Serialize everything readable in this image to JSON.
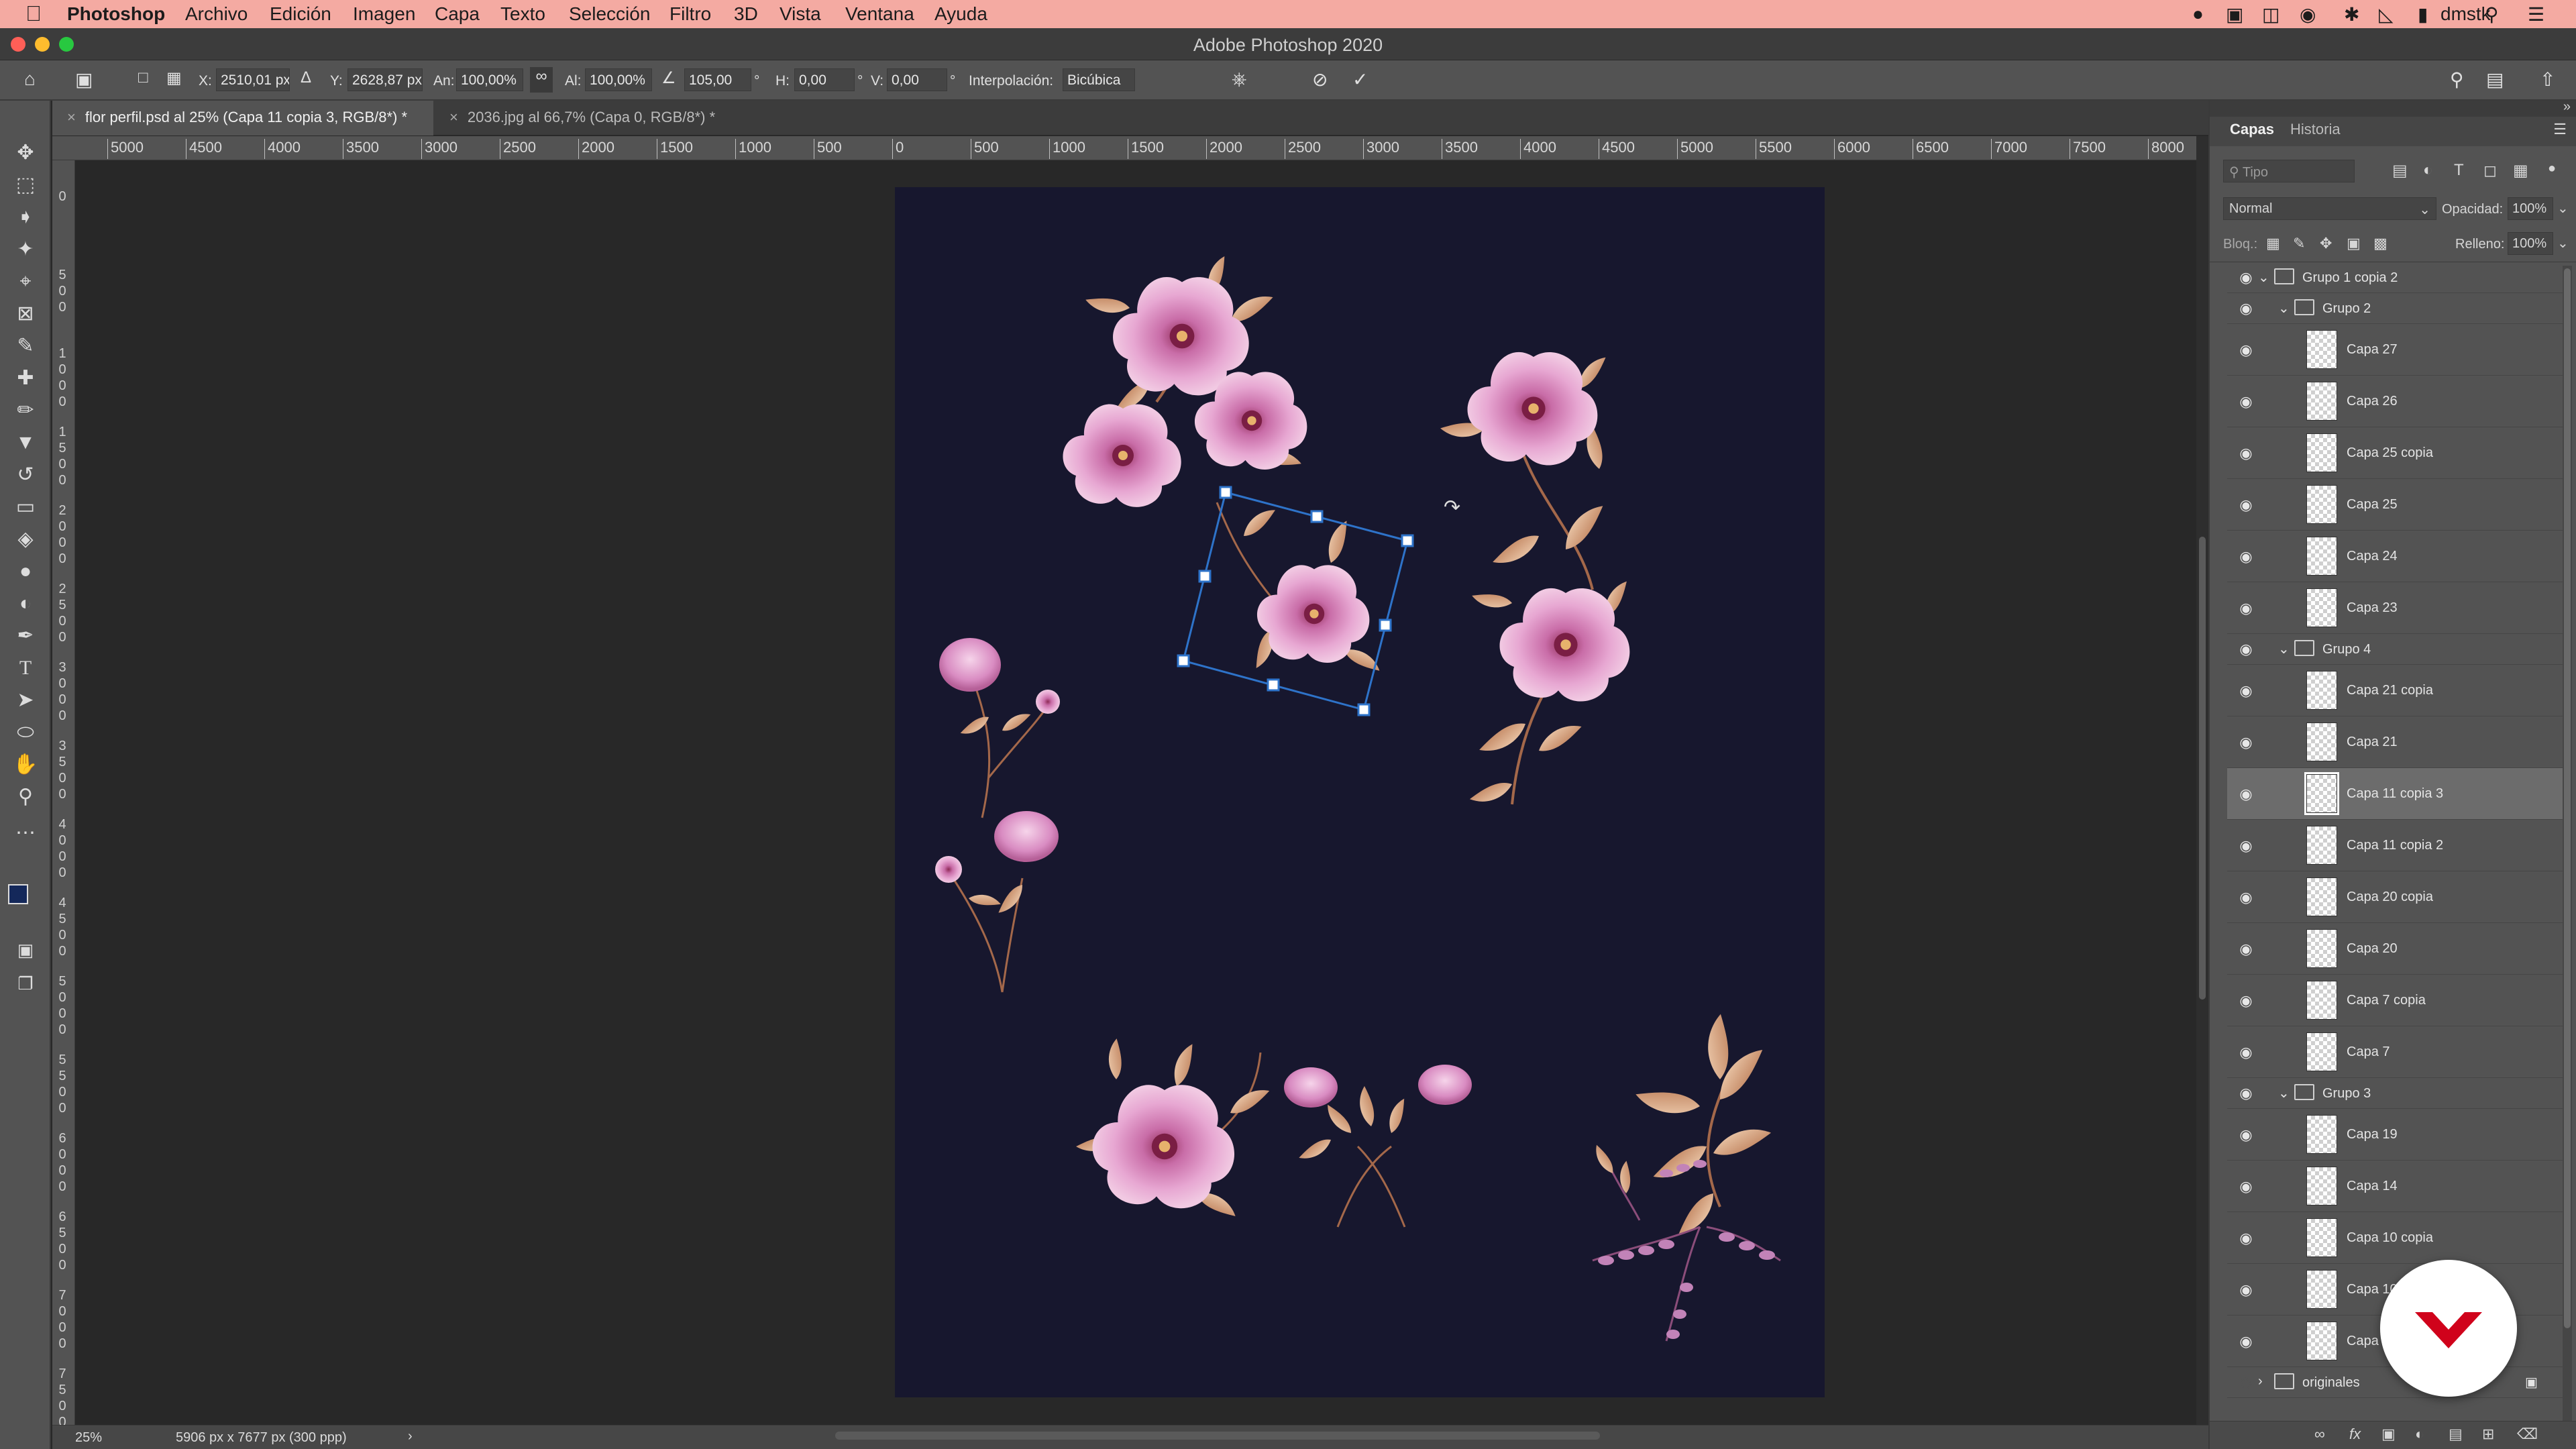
{
  "menubar": {
    "app_name": "Photoshop",
    "items": [
      "Archivo",
      "Edición",
      "Imagen",
      "Capa",
      "Texto",
      "Selección",
      "Filtro",
      "3D",
      "Vista",
      "Ventana",
      "Ayuda"
    ],
    "user": "dmstk"
  },
  "window": {
    "title": "Adobe Photoshop 2020"
  },
  "options": {
    "x_label": "X:",
    "x_value": "2510,01 px",
    "y_label": "Y:",
    "y_value": "2628,87 px",
    "w_label": "An:",
    "w_value": "100,00%",
    "h_label": "Al:",
    "h_value": "100,00%",
    "angle_value": "105,00",
    "deg": "°",
    "skew_h_label": "H:",
    "skew_h_value": "0,00",
    "skew_v_label": "V:",
    "skew_v_value": "0,00",
    "interp_label": "Interpolación:",
    "interp_value": "Bicúbica"
  },
  "tabs": [
    {
      "label": "flor perfil.psd al 25% (Capa 11 copia 3, RGB/8*) *",
      "active": true
    },
    {
      "label": "2036.jpg al 66,7% (Capa 0, RGB/8*) *",
      "active": false
    }
  ],
  "ruler_top": [
    "5000",
    "4500",
    "4000",
    "3500",
    "3000",
    "2500",
    "2000",
    "1500",
    "1000",
    "500",
    "0",
    "500",
    "1000",
    "1500",
    "2000",
    "2500",
    "3000",
    "3500",
    "4000",
    "4500",
    "5000",
    "5500",
    "6000",
    "6500",
    "7000",
    "7500",
    "8000"
  ],
  "ruler_left": [
    "0",
    "5 0 0",
    "1 0 0 0",
    "1 5 0 0",
    "2 0 0 0",
    "2 5 0 0",
    "3 0 0 0",
    "3 5 0 0",
    "4 0 0 0",
    "4 5 0 0",
    "5 0 0 0",
    "5 5 0 0",
    "6 0 0 0",
    "6 5 0 0",
    "7 0 0 0",
    "7 5 0 0"
  ],
  "status": {
    "zoom": "25%",
    "doc_size": "5906 px x 7677 px (300 ppp)"
  },
  "panel": {
    "tab_layers": "Capas",
    "tab_history": "Historia",
    "search_placeholder": "Tipo",
    "blend_mode": "Normal",
    "opacity_label": "Opacidad:",
    "opacity_value": "100%",
    "lock_label": "Bloq.:",
    "fill_label": "Relleno:",
    "fill_value": "100%",
    "layers": [
      {
        "name": "Grupo 1 copia 2",
        "type": "group",
        "level": 0,
        "open": true
      },
      {
        "name": "Grupo 2",
        "type": "group",
        "level": 1,
        "open": true
      },
      {
        "name": "Capa 27",
        "type": "layer",
        "level": 2
      },
      {
        "name": "Capa 26",
        "type": "layer",
        "level": 2
      },
      {
        "name": "Capa 25 copia",
        "type": "layer",
        "level": 2
      },
      {
        "name": "Capa 25",
        "type": "layer",
        "level": 2
      },
      {
        "name": "Capa 24",
        "type": "layer",
        "level": 2
      },
      {
        "name": "Capa 23",
        "type": "layer",
        "level": 2
      },
      {
        "name": "Grupo 4",
        "type": "group",
        "level": 1,
        "open": true
      },
      {
        "name": "Capa 21 copia",
        "type": "layer",
        "level": 2
      },
      {
        "name": "Capa 21",
        "type": "layer",
        "level": 2
      },
      {
        "name": "Capa 11 copia 3",
        "type": "layer",
        "level": 2,
        "selected": true
      },
      {
        "name": "Capa 11 copia 2",
        "type": "layer",
        "level": 2
      },
      {
        "name": "Capa 20 copia",
        "type": "layer",
        "level": 2
      },
      {
        "name": "Capa 20",
        "type": "layer",
        "level": 2
      },
      {
        "name": "Capa 7 copia",
        "type": "layer",
        "level": 2
      },
      {
        "name": "Capa 7",
        "type": "layer",
        "level": 2
      },
      {
        "name": "Grupo 3",
        "type": "group",
        "level": 1,
        "open": true
      },
      {
        "name": "Capa 19",
        "type": "layer",
        "level": 2
      },
      {
        "name": "Capa 14",
        "type": "layer",
        "level": 2
      },
      {
        "name": "Capa 10 copia",
        "type": "layer",
        "level": 2
      },
      {
        "name": "Capa 10",
        "type": "layer",
        "level": 2
      },
      {
        "name": "Capa 9",
        "type": "layer",
        "level": 2
      },
      {
        "name": "originales",
        "type": "group",
        "level": 0,
        "open": false,
        "locked": true
      }
    ]
  },
  "colors": {
    "menubar": "#f4aaa2",
    "artboard": "#17172e",
    "selection": "#2e73c9",
    "badge_mark": "#d0021b"
  }
}
